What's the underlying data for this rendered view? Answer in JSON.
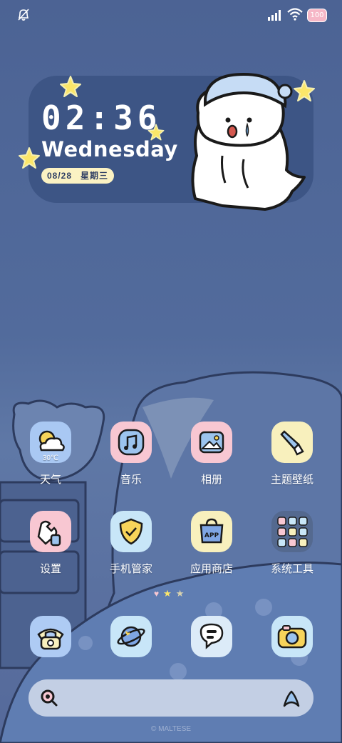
{
  "status": {
    "battery": "100"
  },
  "widget": {
    "time": "02:36",
    "day": "Wednesday",
    "date": "08/28",
    "weekday": "星期三"
  },
  "apps": [
    {
      "id": "weather",
      "label": "天气",
      "sub": "30℃",
      "icon": "weather-icon",
      "color": "#a9c8f3"
    },
    {
      "id": "music",
      "label": "音乐",
      "icon": "music-icon",
      "color": "#f8c7d2"
    },
    {
      "id": "gallery",
      "label": "相册",
      "icon": "gallery-icon",
      "color": "#f8c7d2"
    },
    {
      "id": "themes",
      "label": "主题壁纸",
      "icon": "paintbrush-icon",
      "color": "#f8f0bd"
    },
    {
      "id": "settings",
      "label": "设置",
      "icon": "wrench-icon",
      "color": "#f8c7d2"
    },
    {
      "id": "security",
      "label": "手机管家",
      "icon": "shield-icon",
      "color": "#c8e6f8"
    },
    {
      "id": "appstore",
      "label": "应用商店",
      "icon": "app-bag-icon",
      "color": "#f8f0bd"
    },
    {
      "id": "tools",
      "label": "系统工具",
      "icon": "folder-icon",
      "color": "#54698f"
    }
  ],
  "dock": [
    {
      "id": "phone",
      "icon": "telephone-icon",
      "color": "#aecbf4"
    },
    {
      "id": "browser",
      "icon": "planet-icon",
      "color": "#c8e6f8"
    },
    {
      "id": "messages",
      "icon": "chat-bubble-icon",
      "color": "#dcebf8"
    },
    {
      "id": "camera",
      "icon": "camera-icon",
      "color": "#c8e6f8"
    }
  ],
  "watermark": "© MALTESE"
}
